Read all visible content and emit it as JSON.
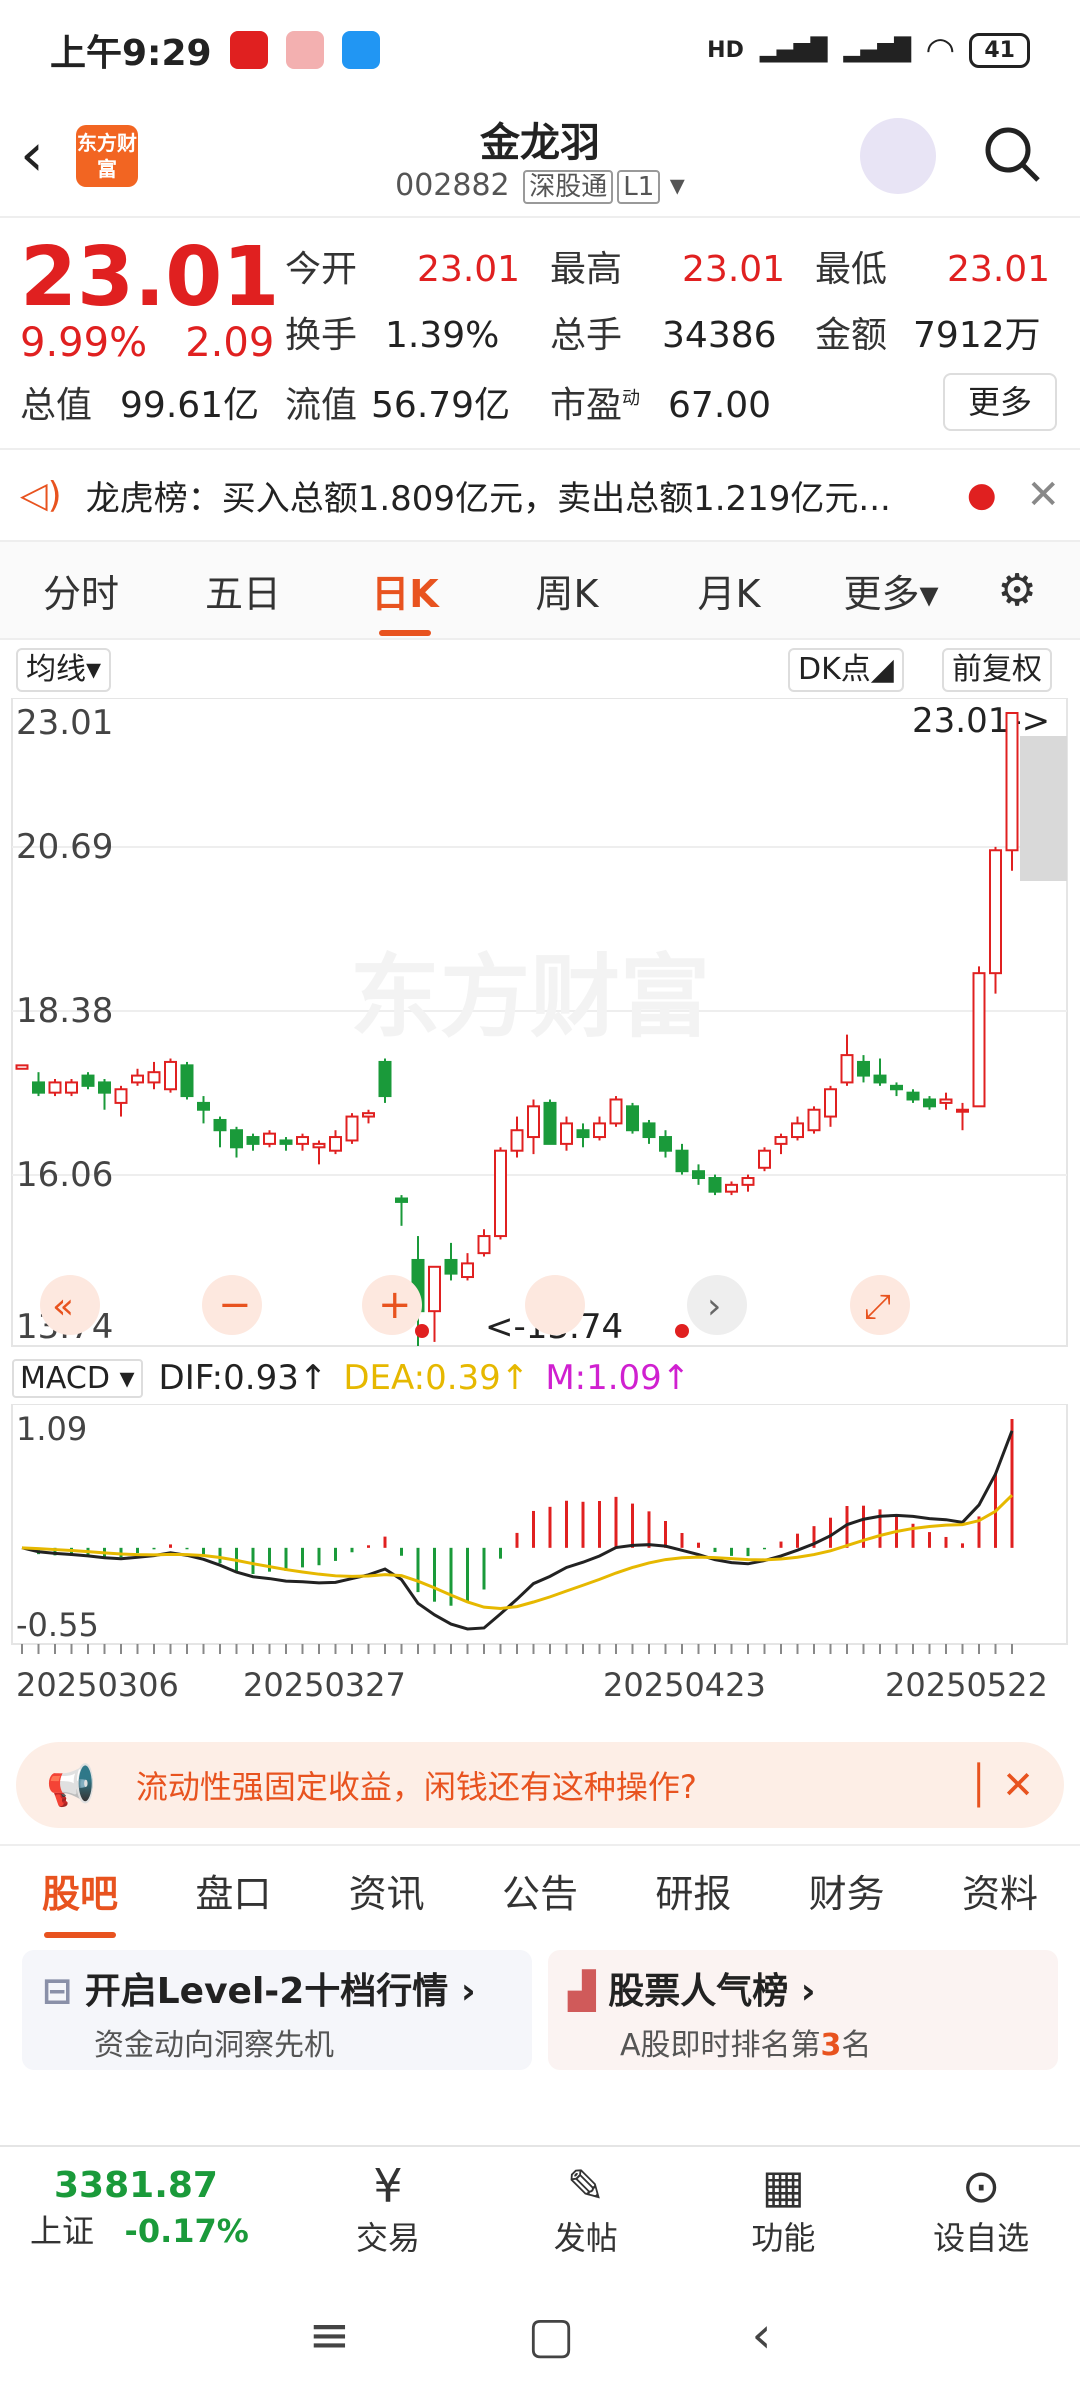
{
  "status": {
    "time": "上午9:29",
    "battery": "41",
    "signal": "HD"
  },
  "header": {
    "name": "金龙羽",
    "code": "002882",
    "tag": "深股通",
    "level": "L1",
    "logo_text": "东方财富"
  },
  "quote": {
    "price": "23.01",
    "pct": "9.99%",
    "chg": "2.09",
    "fields": [
      {
        "k": "今开",
        "v": "23.01"
      },
      {
        "k": "最高",
        "v": "23.01"
      },
      {
        "k": "最低",
        "v": "23.01"
      },
      {
        "k": "换手",
        "v": "1.39%"
      },
      {
        "k": "总手",
        "v": "34386"
      },
      {
        "k": "金额",
        "v": "7912万"
      },
      {
        "k": "总值",
        "v": "99.61亿"
      },
      {
        "k": "流值",
        "v": "56.79亿"
      },
      {
        "k": "市盈",
        "v": "67.00",
        "sup": "动"
      }
    ],
    "more": "更多"
  },
  "notice": {
    "text": "龙虎榜：买入总额1.809亿元，卖出总额1.219亿元..."
  },
  "ktabs": [
    "分时",
    "五日",
    "日K",
    "周K",
    "月K",
    "更多"
  ],
  "chart": {
    "ma_label": "均线",
    "dk_label": "DK点",
    "adj_label": "前复权",
    "watermark": "东方财富",
    "price_labels": [
      "23.01",
      "20.69",
      "18.38",
      "16.06",
      "13.74"
    ],
    "max_label": "23.01->",
    "min_label": "<-13.74",
    "macd_label": "MACD",
    "dif": "DIF:0.93↑",
    "dea": "DEA:0.39↑",
    "m": "M:1.09↑",
    "macd_labels": [
      "1.09",
      "-0.55"
    ],
    "dates": [
      "20250306",
      "20250327",
      "20250423",
      "20250522"
    ]
  },
  "chart_data": {
    "type": "candlestick",
    "ylim": [
      13.74,
      23.01
    ],
    "candles": [
      [
        17.8,
        17.85,
        17.6,
        17.6
      ],
      [
        17.6,
        17.45,
        17.4,
        17.75
      ],
      [
        17.45,
        17.6,
        17.4,
        17.65
      ],
      [
        17.45,
        17.6,
        17.4,
        17.65
      ],
      [
        17.7,
        17.55,
        17.5,
        17.75
      ],
      [
        17.6,
        17.45,
        17.2,
        17.65
      ],
      [
        17.3,
        17.5,
        17.1,
        17.55
      ],
      [
        17.6,
        17.7,
        17.55,
        17.8
      ],
      [
        17.6,
        17.75,
        17.5,
        17.9
      ],
      [
        17.5,
        17.9,
        17.45,
        17.95
      ],
      [
        17.85,
        17.4,
        17.35,
        17.9
      ],
      [
        17.3,
        17.2,
        17.0,
        17.4
      ],
      [
        17.05,
        16.9,
        16.65,
        17.1
      ],
      [
        16.9,
        16.65,
        16.5,
        16.95
      ],
      [
        16.8,
        16.7,
        16.6,
        16.85
      ],
      [
        16.7,
        16.85,
        16.65,
        16.9
      ],
      [
        16.75,
        16.7,
        16.6,
        16.8
      ],
      [
        16.7,
        16.8,
        16.6,
        16.85
      ],
      [
        16.65,
        16.7,
        16.4,
        16.75
      ],
      [
        16.6,
        16.8,
        16.55,
        16.9
      ],
      [
        16.75,
        17.1,
        16.7,
        17.15
      ],
      [
        17.1,
        17.15,
        17.0,
        17.2
      ],
      [
        17.9,
        17.4,
        17.3,
        17.95
      ],
      [
        15.9,
        15.85,
        15.5,
        15.95
      ],
      [
        15.0,
        14.25,
        13.74,
        15.35
      ],
      [
        14.25,
        14.9,
        13.8,
        14.9
      ],
      [
        15.0,
        14.8,
        14.7,
        15.25
      ],
      [
        14.75,
        14.95,
        14.7,
        15.1
      ],
      [
        15.1,
        15.35,
        15.05,
        15.45
      ],
      [
        15.35,
        16.6,
        15.3,
        16.65
      ],
      [
        16.6,
        16.9,
        16.5,
        17.1
      ],
      [
        16.8,
        17.25,
        16.55,
        17.35
      ],
      [
        17.3,
        16.7,
        16.7,
        17.35
      ],
      [
        16.7,
        17.0,
        16.6,
        17.1
      ],
      [
        16.9,
        16.8,
        16.65,
        17.0
      ],
      [
        16.8,
        17.0,
        16.75,
        17.1
      ],
      [
        17.0,
        17.35,
        16.95,
        17.4
      ],
      [
        17.25,
        16.9,
        16.85,
        17.3
      ],
      [
        17.0,
        16.8,
        16.7,
        17.05
      ],
      [
        16.8,
        16.6,
        16.5,
        16.9
      ],
      [
        16.6,
        16.3,
        16.25,
        16.7
      ],
      [
        16.3,
        16.2,
        16.1,
        16.4
      ],
      [
        16.2,
        16.0,
        15.95,
        16.25
      ],
      [
        16.0,
        16.1,
        15.95,
        16.15
      ],
      [
        16.1,
        16.2,
        16.0,
        16.25
      ],
      [
        16.35,
        16.6,
        16.3,
        16.65
      ],
      [
        16.7,
        16.8,
        16.55,
        16.85
      ],
      [
        16.8,
        17.0,
        16.75,
        17.1
      ],
      [
        16.9,
        17.2,
        16.85,
        17.25
      ],
      [
        17.1,
        17.5,
        16.95,
        17.55
      ],
      [
        17.6,
        18.0,
        17.55,
        18.3
      ],
      [
        17.9,
        17.7,
        17.6,
        18.0
      ],
      [
        17.7,
        17.6,
        17.55,
        17.95
      ],
      [
        17.55,
        17.5,
        17.4,
        17.6
      ],
      [
        17.45,
        17.35,
        17.3,
        17.5
      ],
      [
        17.35,
        17.25,
        17.2,
        17.4
      ],
      [
        17.3,
        17.35,
        17.2,
        17.45
      ],
      [
        17.2,
        17.2,
        16.9,
        17.3
      ],
      [
        17.25,
        19.2,
        17.25,
        19.3
      ],
      [
        19.2,
        21.0,
        18.9,
        21.05
      ],
      [
        21.0,
        23.01,
        20.7,
        23.01
      ]
    ],
    "macd": {
      "range": [
        -0.55,
        1.09
      ]
    }
  },
  "ad": {
    "text": "流动性强固定收益，闲钱还有这种操作?"
  },
  "subtabs": [
    "股吧",
    "盘口",
    "资讯",
    "公告",
    "研报",
    "财务",
    "资料"
  ],
  "cards": [
    {
      "title": "开启Level-2十档行情",
      "sub": "资金动向洞察先机"
    },
    {
      "title": "股票人气榜",
      "sub_pre": "A股即时排名第",
      "rank": "3",
      "sub_post": "名"
    }
  ],
  "bottom": {
    "index_val": "3381.87",
    "index_name": "上证",
    "index_chg": "-0.17%",
    "items": [
      "交易",
      "发帖",
      "功能",
      "设自选"
    ]
  }
}
